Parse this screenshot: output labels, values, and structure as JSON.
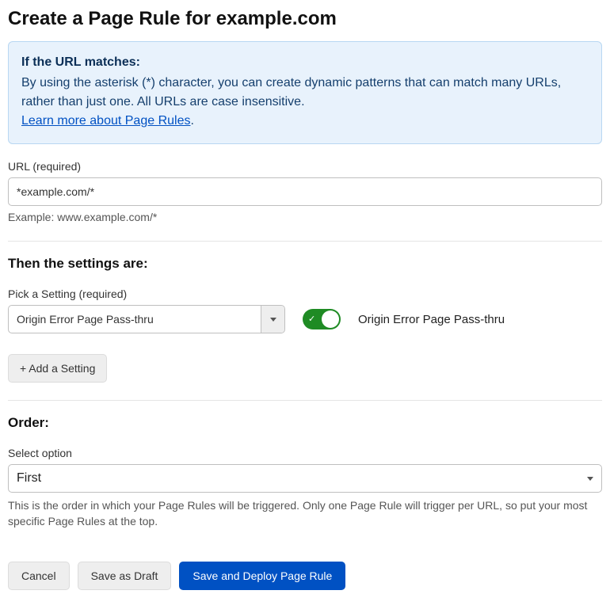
{
  "title": "Create a Page Rule for example.com",
  "info": {
    "title": "If the URL matches:",
    "body": "By using the asterisk (*) character, you can create dynamic patterns that can match many URLs, rather than just one. All URLs are case insensitive.",
    "link_text": "Learn more about Page Rules",
    "period": "."
  },
  "url_section": {
    "label": "URL (required)",
    "value": "*example.com/*",
    "example": "Example: www.example.com/*"
  },
  "settings_section": {
    "title": "Then the settings are:",
    "pick_label": "Pick a Setting (required)",
    "selected": "Origin Error Page Pass-thru",
    "toggle_label": "Origin Error Page Pass-thru",
    "toggle_on": true,
    "add_button": "+ Add a Setting"
  },
  "order_section": {
    "title": "Order:",
    "label": "Select option",
    "selected": "First",
    "help": "This is the order in which your Page Rules will be triggered. Only one Page Rule will trigger per URL, so put your most specific Page Rules at the top."
  },
  "actions": {
    "cancel": "Cancel",
    "draft": "Save as Draft",
    "deploy": "Save and Deploy Page Rule"
  }
}
